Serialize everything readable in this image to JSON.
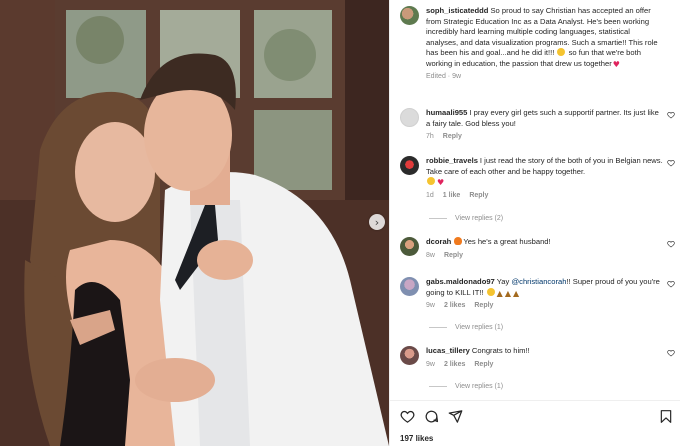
{
  "caption": {
    "username": "soph_isticateddd",
    "text": "So proud to say Christian has accepted an offer from Strategic Education Inc as a Data Analyst. He's been working incredibly hard learning multiple coding languages, statistical analyses, and data visualization programs. Such a smartie!! This role has been his and goal...and he did it!!! ",
    "text_end": " so fun that we're both working in education, the passion that drew us together",
    "meta": "Edited · 9w"
  },
  "comments": [
    {
      "username": "humaali955",
      "text": "I pray every girl gets such a supportif partner. Its just like a fairy tale. God bless you!",
      "time": "7h",
      "reply": "Reply"
    },
    {
      "username": "robbie_travels",
      "text": "I just read the story of the both of you in Belgian news. Take care of each other and be happy together.",
      "time": "1d",
      "likes": "1 like",
      "reply": "Reply",
      "view_replies": "View replies (2)"
    },
    {
      "username": "dcorah",
      "text": "Yes he's a great husband!",
      "time": "8w",
      "reply": "Reply"
    },
    {
      "username": "gabs.maldonado97",
      "text_before": "Yay ",
      "mention": "@christiancorah",
      "text_after": "!! Super proud of you you're going to KILL IT!! ",
      "time": "9w",
      "likes": "2 likes",
      "reply": "Reply",
      "view_replies": "View replies (1)"
    },
    {
      "username": "lucas_tillery",
      "text": "Congrats to him!!",
      "time": "9w",
      "likes": "2 likes",
      "reply": "Reply",
      "view_replies": "View replies (1)"
    }
  ],
  "likes_count": "197 likes",
  "icons": {
    "like": "heart-icon",
    "comment": "comment-icon",
    "share": "share-icon",
    "save": "bookmark-icon",
    "next": "chevron-right-icon"
  },
  "colors": {
    "text": "#262626",
    "secondary": "#8e8e8e",
    "mention": "#00376b",
    "heart": "#e0245e"
  }
}
